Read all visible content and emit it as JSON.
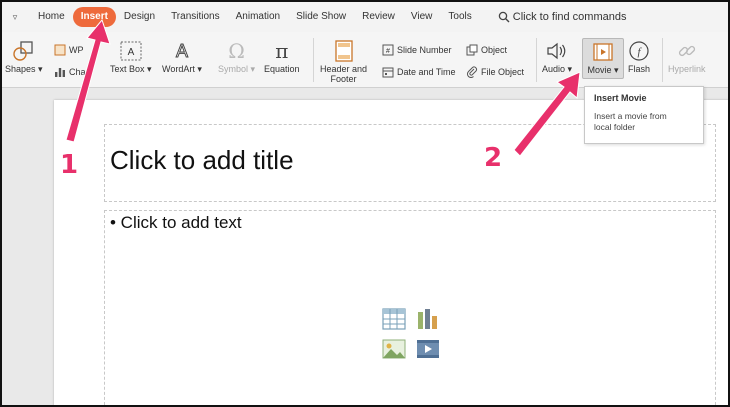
{
  "menu": {
    "tabs": [
      "Home",
      "Insert",
      "Design",
      "Transitions",
      "Animation",
      "Slide Show",
      "Review",
      "View",
      "Tools"
    ],
    "active_tab": "Insert",
    "search_placeholder": "Click to find commands"
  },
  "ribbon": {
    "shapes": "Shapes",
    "wps_partial": "WP",
    "chart_partial": "Cha",
    "text_box": "Text Box",
    "wordart": "WordArt",
    "symbol": "Symbol",
    "equation": "Equation",
    "header_footer_line1": "Header and",
    "header_footer_line2": "Footer",
    "slide_number": "Slide Number",
    "date_time": "Date and Time",
    "object": "Object",
    "file_object": "File Object",
    "audio": "Audio",
    "movie": "Movie",
    "flash": "Flash",
    "hyperlink": "Hyperlink"
  },
  "tooltip": {
    "title": "Insert Movie",
    "description_line1": "Insert a movie from",
    "description_line2": "local folder"
  },
  "slide": {
    "title_placeholder": "Click to add title",
    "body_placeholder": "• Click to add text"
  },
  "annotations": {
    "step1": "1",
    "step2": "2",
    "arrow_color": "#e8306b"
  },
  "colors": {
    "accent": "#ee6a3c",
    "annotation": "#e8306b"
  }
}
